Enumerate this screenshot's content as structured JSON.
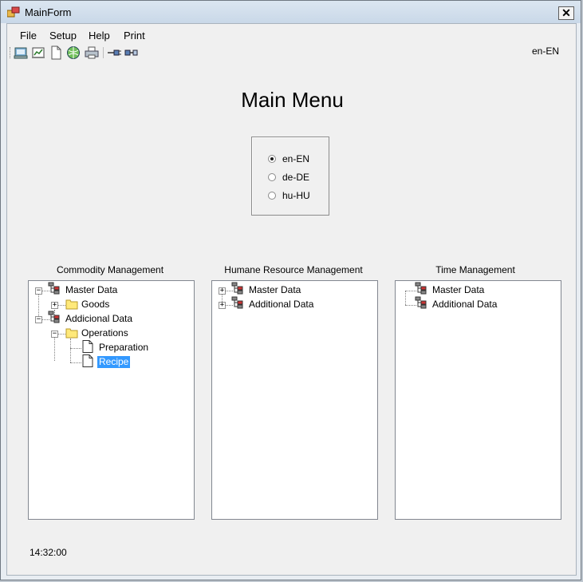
{
  "window": {
    "title": "MainForm",
    "close_glyph": "✕",
    "app_icon": "app-icon"
  },
  "menu": {
    "items": [
      "File",
      "Setup",
      "Help",
      "Print"
    ]
  },
  "toolbar": {
    "buttons": [
      "report-icon",
      "chart-icon",
      "document-icon",
      "globe-icon",
      "printer-icon",
      "plug-out-icon",
      "plug-in-icon"
    ],
    "current_language": "en-EN"
  },
  "main": {
    "title": "Main Menu",
    "languages": [
      {
        "label": "en-EN",
        "checked": true
      },
      {
        "label": "de-DE",
        "checked": false
      },
      {
        "label": "hu-HU",
        "checked": false
      }
    ]
  },
  "panels": [
    {
      "title": "Commodity Management",
      "nodes": [
        {
          "label": "Master Data",
          "icon": "database-icon",
          "expander": "−"
        },
        {
          "label": "Goods",
          "icon": "folder-icon",
          "expander": "+"
        },
        {
          "label": "Addicional Data",
          "icon": "database-icon",
          "expander": "−"
        },
        {
          "label": "Operations",
          "icon": "folder-icon",
          "expander": "−"
        },
        {
          "label": "Preparation",
          "icon": "page-icon",
          "expander": ""
        },
        {
          "label": "Recipe",
          "icon": "page-icon",
          "expander": "",
          "selected": true
        }
      ]
    },
    {
      "title": "Humane Resource Management",
      "nodes": [
        {
          "label": "Master Data",
          "icon": "database-icon",
          "expander": "+"
        },
        {
          "label": "Additional Data",
          "icon": "database-icon",
          "expander": "+"
        }
      ]
    },
    {
      "title": "Time Management",
      "nodes": [
        {
          "label": "Master Data",
          "icon": "database-icon",
          "expander": ""
        },
        {
          "label": "Additional Data",
          "icon": "database-icon",
          "expander": ""
        }
      ]
    }
  ],
  "status": {
    "clock": "14:32:00"
  },
  "colors": {
    "selection": "#3399ff",
    "folder": "#ffe97a",
    "titlebar": "#c9d8e8"
  }
}
